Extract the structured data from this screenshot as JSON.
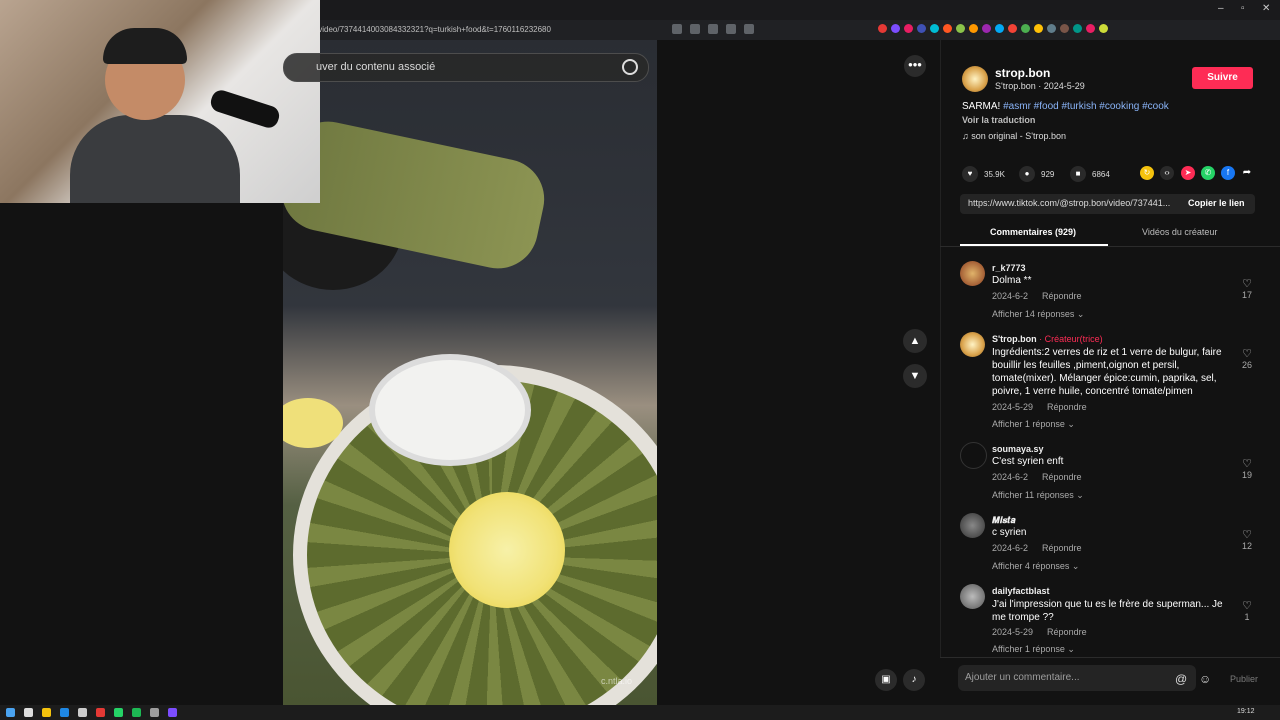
{
  "browser": {
    "url": "/video/7374414003084332321?q=turkish+food&t=1760116232680",
    "colors": {
      "ext_icons": [
        "#e53935",
        "#7c4dff",
        "#e91e63",
        "#3f51b5",
        "#00bcd4",
        "#ff5722",
        "#8bc34a",
        "#ff9800",
        "#9c27b0",
        "#03a9f4",
        "#f44336",
        "#4caf50",
        "#ffc107",
        "#607d8b",
        "#795548",
        "#009688",
        "#e91e63",
        "#cddc39"
      ]
    }
  },
  "search": {
    "placeholder": "uver du contenu associé"
  },
  "icons": {
    "search": "search-icon",
    "more": "more-horizontal-icon",
    "up": "chevron-up-icon",
    "down": "chevron-down-icon",
    "pip": "picture-in-picture-icon",
    "volume": "volume-icon"
  },
  "video": {
    "watermark": "c.ntla.io"
  },
  "creator": {
    "username": "strop.bon",
    "display_name": "S'trop.bon",
    "date": "2024-5-29",
    "follow_label": "Suivre"
  },
  "caption": {
    "text": "SARMA!",
    "hashtags": "#asmr #food #turkish #cooking #cook",
    "translate_label": "Voir la traduction",
    "music": "son original - S'trop.bon"
  },
  "stats": {
    "likes": "35.9K",
    "comments": "929",
    "saves": "6864"
  },
  "share": {
    "link": "https://www.tiktok.com/@strop.bon/video/737441...",
    "copy_label": "Copier le lien"
  },
  "tabs": {
    "comments": "Commentaires (929)",
    "creator_videos": "Vidéos du créateur"
  },
  "comments": [
    {
      "user": "r_k7773",
      "badge": "",
      "text": "Dolma **",
      "date": "2024-6-2",
      "reply_label": "Répondre",
      "replies": "Afficher 14 réponses",
      "likes": "17"
    },
    {
      "user": "S'trop.bon",
      "badge": "· Créateur(trice)",
      "text": "Ingrédients:2 verres de riz et 1 verre de bulgur, faire bouillir les feuilles ,piment,oignon et persil, tomate(mixer). Mélanger épice:cumin, paprika, sel, poivre, 1 verre huile, concentré tomate/pimen",
      "date": "2024-5-29",
      "reply_label": "Répondre",
      "replies": "Afficher 1 réponse",
      "likes": "26"
    },
    {
      "user": "soumaya.sy",
      "badge": "",
      "text": "C'est syrien enft",
      "date": "2024-6-2",
      "reply_label": "Répondre",
      "replies": "Afficher 11 réponses",
      "likes": "19"
    },
    {
      "user": "𝑴𝒊𝒔𝒕𝒂",
      "badge": "",
      "text": "c syrien",
      "date": "2024-6-2",
      "reply_label": "Répondre",
      "replies": "Afficher 4 réponses",
      "likes": "12"
    },
    {
      "user": "dailyfactblast",
      "badge": "",
      "text": "J'ai l'impression que tu es le frère de superman... Je me trompe ??",
      "date": "2024-5-29",
      "reply_label": "Répondre",
      "replies": "Afficher 1 réponse",
      "likes": "1"
    }
  ],
  "comment_input": {
    "placeholder": "Ajouter un commentaire...",
    "publish_label": "Publier"
  },
  "taskbar": {
    "time": "19:12"
  }
}
